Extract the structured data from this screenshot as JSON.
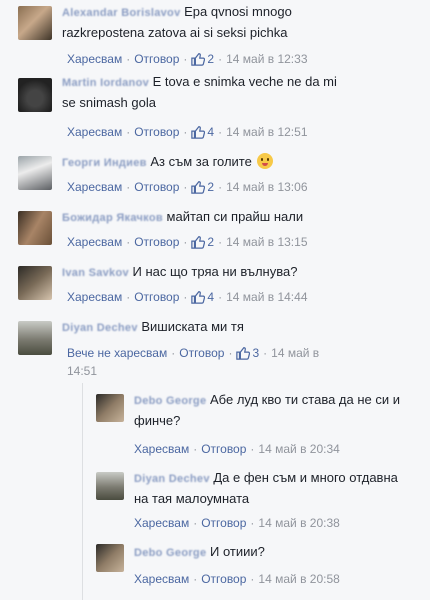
{
  "labels": {
    "like": "Харесвам",
    "unlike": "Вече не харесвам",
    "reply": "Отговор",
    "dot": "·"
  },
  "colors": {
    "link": "#4b67a1",
    "meta": "#90949c",
    "author": "#8b9dc3"
  },
  "comments": [
    {
      "author": "Alexandar Borislavov",
      "text": "Epa qvnosi mnogo razkrepostena zatova ai si seksi pichka",
      "like_label": "Харесвам",
      "likes": "2",
      "time": "14 май в 12:33",
      "avatar_icon": "user-photo-icon"
    },
    {
      "author": "Martin Iordanov",
      "text": "E tova e snimka veche ne da mi se snimash gola",
      "like_label": "Харесвам",
      "likes": "4",
      "time": "14 май в 12:51",
      "avatar_icon": "user-photo-icon"
    },
    {
      "author": "Георги Индиев",
      "text": "Аз съм за голите",
      "emoji": "tongue-face-emoji",
      "like_label": "Харесвам",
      "likes": "2",
      "time": "14 май в 13:06",
      "avatar_icon": "user-photo-icon"
    },
    {
      "author": "Божидар Якачков",
      "text": "майтап си прайш нали",
      "like_label": "Харесвам",
      "likes": "2",
      "time": "14 май в 13:15",
      "avatar_icon": "user-photo-icon"
    },
    {
      "author": "Ivan Savkov",
      "text": "И нас що тряа ни вълнува?",
      "like_label": "Харесвам",
      "likes": "4",
      "time": "14 май в 14:44",
      "avatar_icon": "user-photo-icon"
    },
    {
      "author": "Diyan Dechev",
      "text": "Вишиската ми тя",
      "like_label": "Вече не харесвам",
      "likes": "3",
      "time_part1": "14 май в",
      "time_part2": "14:51",
      "avatar_icon": "user-photo-icon"
    }
  ],
  "replies": [
    {
      "author": "Debo George",
      "text": "Абе луд кво ти става да не си и финче?",
      "like_label": "Харесвам",
      "time": "14 май в 20:34",
      "avatar_icon": "user-photo-icon"
    },
    {
      "author": "Diyan Dechev",
      "text": "Да е фен съм и много отдавна на тая малоумната",
      "like_label": "Харесвам",
      "time": "14 май в 20:38",
      "avatar_icon": "user-photo-icon"
    },
    {
      "author": "Debo George",
      "text": "И отиии?",
      "like_label": "Харесвам",
      "time": "14 май в 20:58",
      "avatar_icon": "user-photo-icon"
    }
  ]
}
